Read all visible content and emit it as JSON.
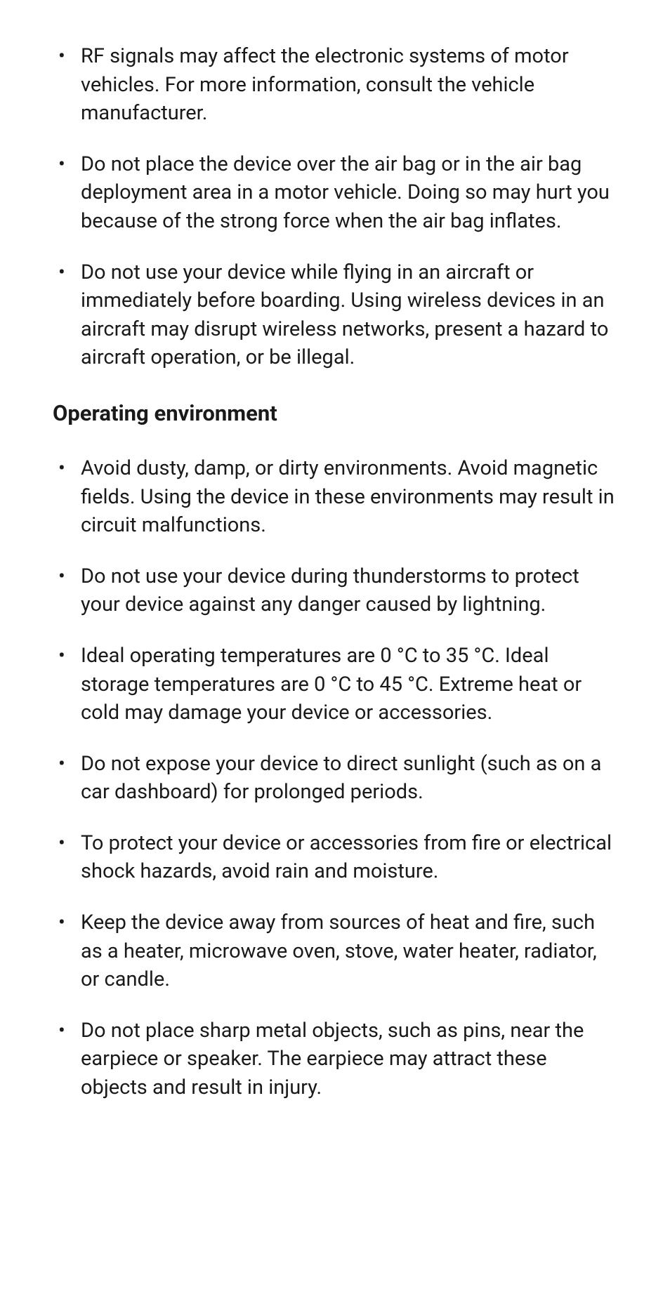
{
  "sections": [
    {
      "items": [
        "RF signals may affect the electronic systems of motor vehicles. For more information, consult the vehicle manufacturer.",
        "Do not place the device over the air bag or in the air bag deployment area in a motor vehicle. Doing so may hurt you because of the strong force when the air bag inflates.",
        "Do not use your device while flying in an aircraft or immediately before boarding. Using wireless devices in an aircraft may disrupt wireless networks, present a hazard to aircraft operation, or be illegal."
      ]
    },
    {
      "heading": "Operating environment",
      "items": [
        "Avoid dusty, damp, or dirty environments. Avoid magnetic fields. Using the device in these environments may result in circuit malfunctions.",
        "Do not use your device during thunderstorms to protect your device against any danger caused by lightning.",
        "Ideal operating temperatures are 0 °C to 35 °C. Ideal storage temperatures are 0 °C to 45 °C. Extreme heat or cold may damage your device or accessories.",
        "Do not expose your device to direct sunlight (such as on a car dashboard) for prolonged periods.",
        "To protect your device or accessories from fire or electrical shock hazards, avoid rain and moisture.",
        "Keep the device away from sources of heat and fire, such as a heater, microwave oven, stove, water heater, radiator, or candle.",
        "Do not place sharp metal objects, such as pins, near the earpiece or speaker. The earpiece may attract these objects and result in injury."
      ]
    }
  ]
}
